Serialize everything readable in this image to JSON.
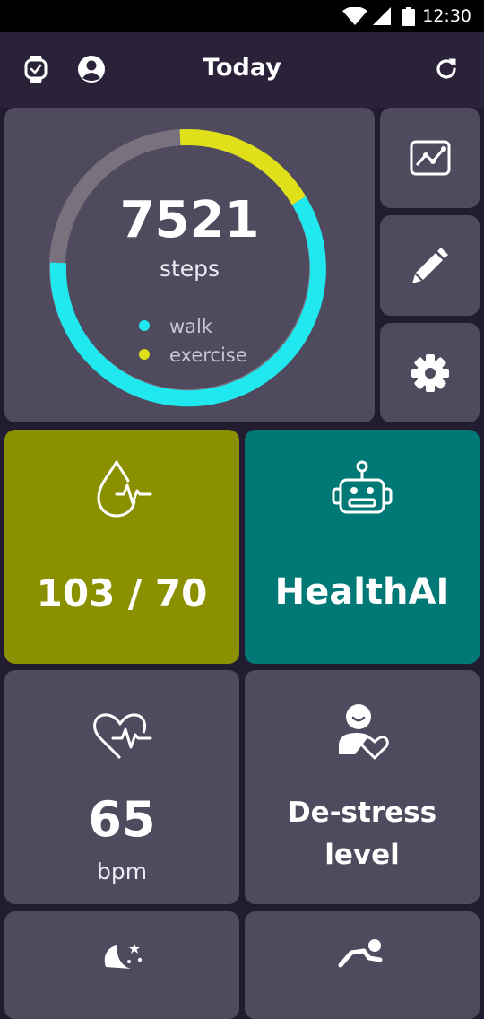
{
  "status_bar": {
    "time": "12:30"
  },
  "app_bar": {
    "title": "Today"
  },
  "steps_card": {
    "value": "7521",
    "unit": "steps",
    "legend": [
      {
        "label": "walk",
        "color": "#1fe9ef"
      },
      {
        "label": "exercise",
        "color": "#dfe01a"
      }
    ],
    "ring_track_color": "#78727f"
  },
  "side_buttons": [
    {
      "icon": "chart-icon"
    },
    {
      "icon": "pencil-icon"
    },
    {
      "icon": "gear-icon"
    }
  ],
  "tiles": {
    "blood_pressure": {
      "value": "103 / 70",
      "icon": "blood-drop-pulse-icon",
      "color": "#8a9000"
    },
    "health_ai": {
      "label": "HealthAI",
      "icon": "robot-icon",
      "color": "#007875"
    },
    "heart_rate": {
      "value": "65",
      "unit": "bpm",
      "icon": "heart-pulse-icon"
    },
    "destress": {
      "line1": "De-stress",
      "line2": "level",
      "icon": "person-heart-icon"
    },
    "sleep": {
      "icon": "moon-stars-icon"
    },
    "activity": {
      "icon": "running-person-icon"
    }
  }
}
